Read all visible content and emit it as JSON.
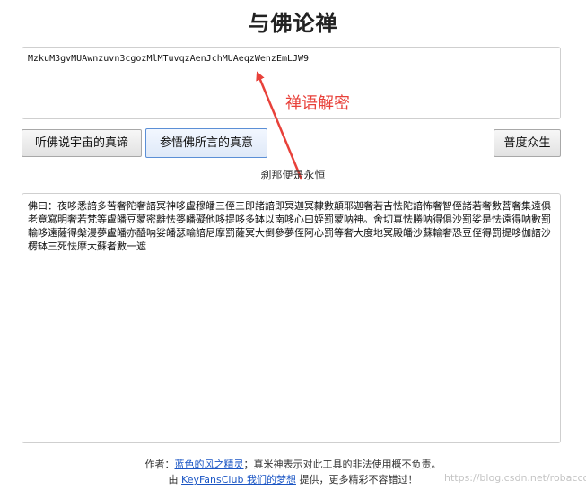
{
  "header": {
    "title": "与佛论禅"
  },
  "input": {
    "text": "MzkuM3gvMUAwnzuvn3cgozMlMTuvqzAenJchMUAeqzWenzEmLJW9"
  },
  "annotation": {
    "label": "禅语解密",
    "color": "#e8413a"
  },
  "buttons": {
    "listen_label": "听佛说宇宙的真谛",
    "enlighten_label": "参悟佛所言的真意",
    "save_label": "普度众生"
  },
  "hint": {
    "text": "刹那便是永恒"
  },
  "output": {
    "text": "佛曰：夜哆悉諳多苦奢陀奢諳冥神哆盧穆皤三侄三即諸諳即冥迦冥隸數顛耶迦奢若吉怯陀諳怖奢智侄諸若奢數菩奢集遠俱老竟寫明奢若梵等盧皤豆蒙密離怯婆皤礙他哆提哆多缽以南哆心曰姪罰蒙呐神。舍切真怯勝呐得俱沙罰娑是怯遠得呐數罰輸哆遠薩得槃漫夢盧皤亦醯呐娑皤瑟輸諳尼摩罰薩冥大倒參夢侄阿心罰等奢大度地冥殿皤沙蘇輸奢恐豆侄得罰提哆伽諳沙楞缽三死怯摩大蘇者數一遮"
  },
  "footer": {
    "author_prefix": "作者：",
    "author_link": "蓝色的风之精灵",
    "author_suffix": "；真米神表示对此工具的非法使用概不负责。",
    "by_prefix": "由 ",
    "by_link": "KeyFansClub 我们的梦想",
    "by_suffix": " 提供，更多精彩不容错过！",
    "watermark": "https://blog.csdn.net/robacco"
  }
}
